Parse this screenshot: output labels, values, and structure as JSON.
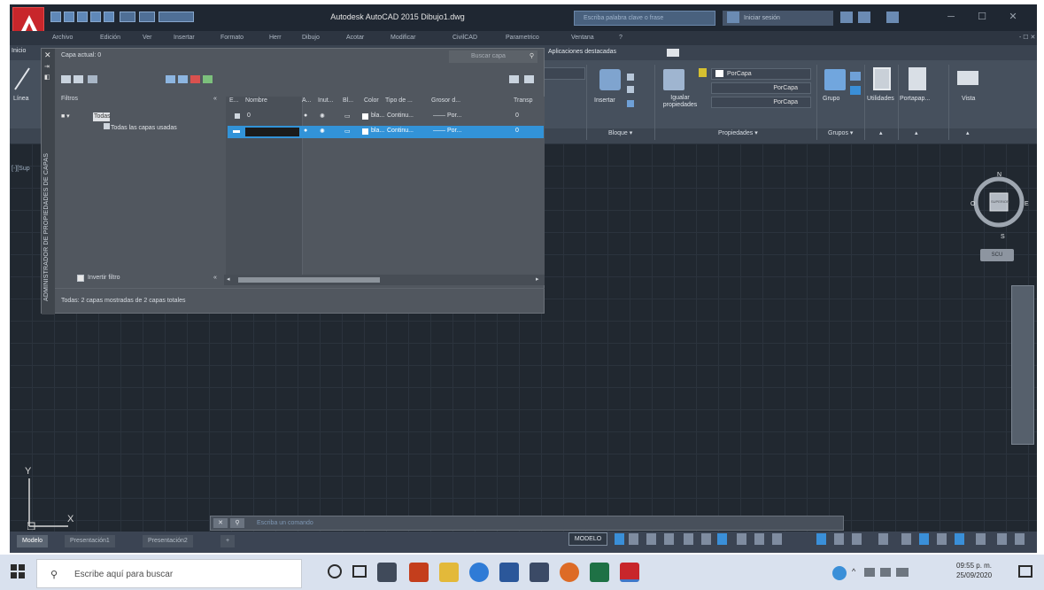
{
  "window": {
    "title": "Autodesk AutoCAD 2015    Dibujo1.dwg",
    "help_search_placeholder": "Escriba palabra clave o frase",
    "signin_label": "Iniciar sesión"
  },
  "menubar": {
    "items": [
      "Archivo",
      "Edición",
      "Ver",
      "Insertar",
      "Formato",
      "Herr",
      "Dibujo",
      "Acotar",
      "Modificar",
      "CivilCAD",
      "Parametrico",
      "Ventana",
      "?"
    ]
  },
  "ribbon": {
    "tab_active_label": "Aplicaciones destacadas",
    "left_label_top": "Inicio",
    "left_label_line": "Línea",
    "insert_label": "Insertar",
    "match_props_label": "Igualar propiedades",
    "panel_block": "Bloque",
    "panel_properties": "Propiedades",
    "panel_groups": "Grupos",
    "group_label": "Grupo",
    "utilities_label": "Utilidades",
    "clipboard_label": "Portapap...",
    "view_label": "Vista",
    "color_value": "PorCapa",
    "linetype_value": "PorCapa",
    "lineweight_value": "PorCapa"
  },
  "layer_manager": {
    "side_title": "ADMINISTRADOR DE PROPIEDADES DE CAPAS",
    "current_layer": "Capa actual: 0",
    "search_placeholder": "Buscar capa",
    "filters_header": "Filtros",
    "tree_root": "Todas",
    "tree_used": "Todas las capas usadas",
    "columns": [
      "E...",
      "Nombre",
      "A...",
      "Inut...",
      "Bl...",
      "Color",
      "Tipo de ...",
      "Grosor d...",
      "Transp"
    ],
    "rows": [
      {
        "name": "0",
        "color": "bla...",
        "linetype": "Continu...",
        "lineweight": "Por...",
        "transparency": "0"
      },
      {
        "name": "",
        "color": "bla...",
        "linetype": "Continu...",
        "lineweight": "Por...",
        "transparency": "0"
      }
    ],
    "invert_filter_label": "Invertir filtro",
    "status_summary": "Todas: 2 capas mostradas de 2 capas totales"
  },
  "drawing": {
    "viewport_label": "[-][Sup",
    "ucs_y": "Y",
    "ucs_x": "X",
    "viewcube_top": "SUPERIOR",
    "viewcube_n": "N",
    "viewcube_s": "S",
    "viewcube_e": "E",
    "viewcube_o": "O",
    "viewcube_wcs": "SCU"
  },
  "command_line": {
    "placeholder": "Escriba un comando",
    "close_label": "✕",
    "search_label": "⚲"
  },
  "layout_tabs": [
    "Modelo",
    "Presentación1",
    "Presentación2",
    "+"
  ],
  "statusbar": {
    "model_label": "MODELO"
  },
  "taskbar": {
    "search_placeholder": "Escribe aquí para buscar",
    "time": "09:55 p. m.",
    "date": "25/09/2020"
  },
  "colors": {
    "accent": "#3293d8",
    "drawing_bg": "#212830",
    "app_red": "#c8262b"
  }
}
